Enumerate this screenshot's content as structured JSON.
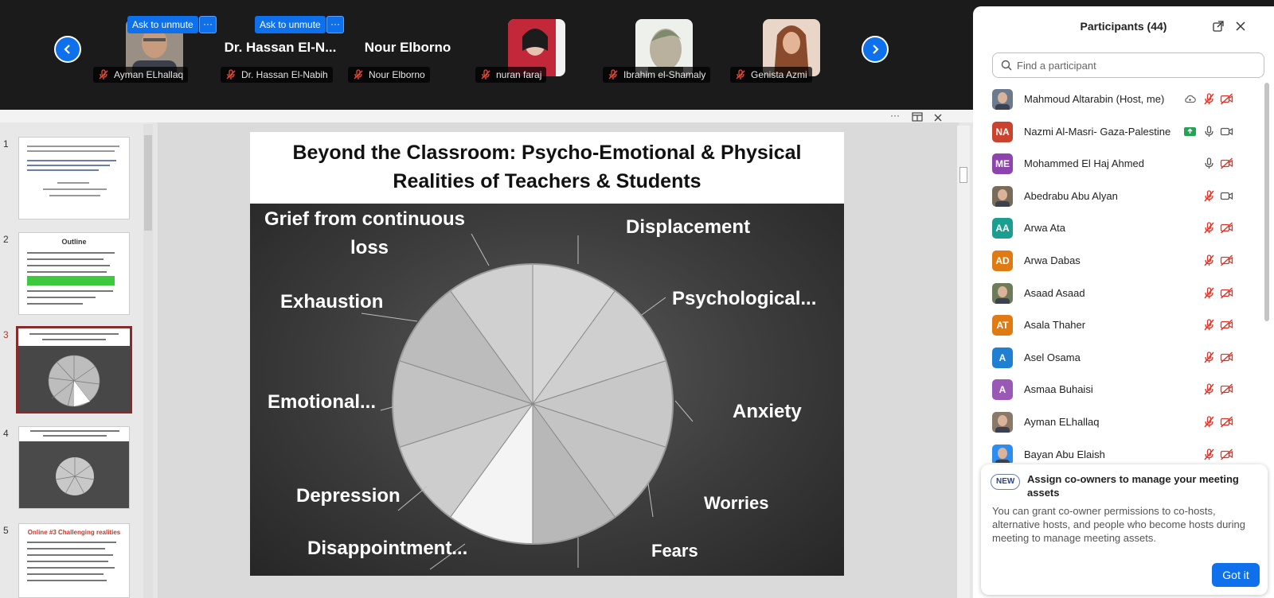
{
  "gallery": {
    "prev_icon": "chevron-left-icon",
    "next_icon": "chevron-right-icon",
    "ask_unmute_label": "Ask to unmute",
    "more_label": "···",
    "tiles": [
      {
        "name": "Ayman ELhallaq",
        "has_photo": true
      },
      {
        "name": "Dr. Hassan El-Nabih",
        "big_name": "Dr. Hassan El-N..."
      },
      {
        "name": "Nour Elborno",
        "big_name": "Nour Elborno"
      },
      {
        "name": "nuran faraj",
        "has_photo": true
      },
      {
        "name": "Ibrahim el-Shamaly",
        "has_photo": true
      },
      {
        "name": "Genista Azmi",
        "has_photo": true
      }
    ]
  },
  "share": {
    "more_label": "···",
    "thumbnails": [
      {
        "num": "1"
      },
      {
        "num": "2",
        "title": "Outline"
      },
      {
        "num": "3",
        "selected": true
      },
      {
        "num": "4"
      },
      {
        "num": "5",
        "title": "Online #3 Challenging realities"
      }
    ],
    "slide": {
      "title_line1": "Beyond the Classroom: Psycho-Emotional & Physical",
      "title_line2": "Realities of Teachers & Students",
      "labels": {
        "grief_1": "Grief from continuous",
        "grief_2": "loss",
        "displacement": "Displacement",
        "psychological": "Psychological...",
        "exhaustion": "Exhaustion",
        "emotional": "Emotional...",
        "anxiety": "Anxiety",
        "depression": "Depression",
        "worries": "Worries",
        "disappointment": "Disappointment...",
        "fears": "Fears"
      }
    }
  },
  "participants": {
    "title": "Participants (44)",
    "search_placeholder": "Find a participant",
    "list": [
      {
        "name": "Mahmoud Altarabin (Host, me)",
        "initials": "",
        "color": "#6b7a8c",
        "mic": "muted",
        "video": "off",
        "extra": "cloud"
      },
      {
        "name": "Nazmi Al-Masri- Gaza-Palestine",
        "initials": "NA",
        "color": "#c9432e",
        "mic": "on",
        "video": "on",
        "extra": "share"
      },
      {
        "name": "Mohammed El Haj Ahmed",
        "initials": "ME",
        "color": "#8e44ad",
        "mic": "on",
        "video": "off"
      },
      {
        "name": "Abedrabu Abu Alyan",
        "initials": "",
        "color": "#7a6a5a",
        "mic": "muted",
        "video": "on"
      },
      {
        "name": "Arwa Ata",
        "initials": "AA",
        "color": "#1a9e8f",
        "mic": "muted",
        "video": "off"
      },
      {
        "name": "Arwa Dabas",
        "initials": "AD",
        "color": "#e07b13",
        "mic": "muted",
        "video": "off"
      },
      {
        "name": "Asaad Asaad",
        "initials": "",
        "color": "#6e7b5a",
        "mic": "muted",
        "video": "off"
      },
      {
        "name": "Asala Thaher",
        "initials": "AT",
        "color": "#e07b13",
        "mic": "muted",
        "video": "off"
      },
      {
        "name": "Asel Osama",
        "initials": "A",
        "color": "#1f7fd1",
        "mic": "muted",
        "video": "off"
      },
      {
        "name": "Asmaa Buhaisi",
        "initials": "A",
        "color": "#9b59b6",
        "mic": "muted",
        "video": "off"
      },
      {
        "name": "Ayman ELhallaq",
        "initials": "",
        "color": "#8a7868",
        "mic": "muted",
        "video": "off"
      },
      {
        "name": "Bayan Abu Elaish",
        "initials": "",
        "color": "#2d8cf0",
        "mic": "muted",
        "video": "off"
      }
    ]
  },
  "notice": {
    "badge": "NEW",
    "title": "Assign co-owners to manage your meeting assets",
    "body": "You can grant co-owner permissions to co-hosts, alternative hosts, and people who become hosts during meeting to manage meeting assets.",
    "button": "Got it"
  },
  "colors": {
    "accent": "#0e71eb",
    "muted_red": "#d9352b",
    "selected_slide_border": "#8a2b2b"
  }
}
